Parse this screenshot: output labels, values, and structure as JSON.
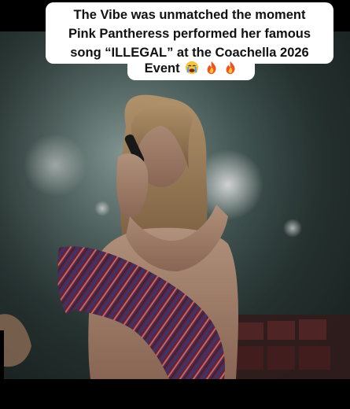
{
  "caption": {
    "line1": "The Vibe was unmatched the moment",
    "line2": "Pink Pantheress performed her famous",
    "line3": "song “ILLEGAL” at the Coachella 2026",
    "line4": "Event"
  },
  "emojis": [
    "crying-face-icon",
    "fire-icon",
    "fire-icon"
  ],
  "colors": {
    "background": "#000000",
    "caption_bg": "#ffffff",
    "caption_text": "#111111",
    "stage_haze": "#5f7a76",
    "garment_red": "#8c2a3a",
    "garment_blue": "#3a3f7a"
  }
}
